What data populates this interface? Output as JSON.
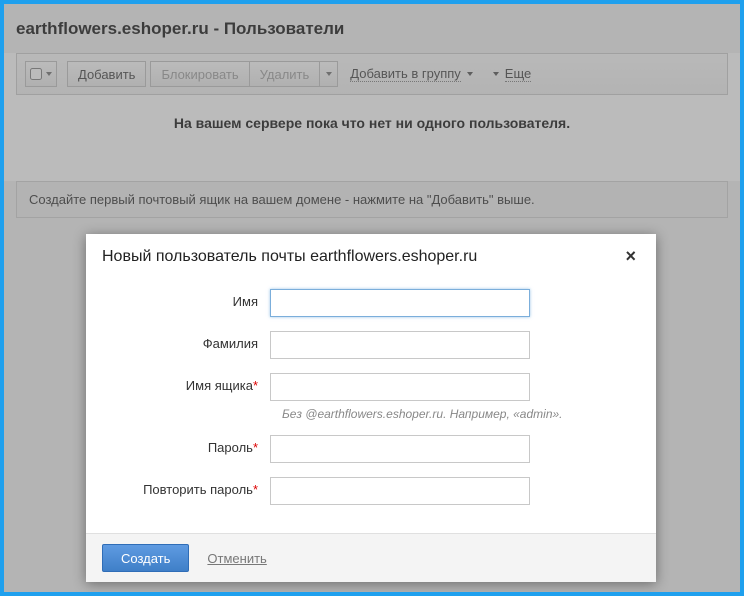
{
  "page": {
    "title": "earthflowers.eshoper.ru - Пользователи"
  },
  "toolbar": {
    "add": "Добавить",
    "block": "Блокировать",
    "delete": "Удалить",
    "add_to_group": "Добавить в группу",
    "more": "Еще"
  },
  "empty_message": "На вашем сервере пока что нет ни одного пользователя.",
  "info_message": "Создайте первый почтовый ящик на вашем домене - нажмите на \"Добавить\" выше.",
  "dialog": {
    "title": "Новый пользователь почты earthflowers.eshoper.ru",
    "fields": {
      "first_name": "Имя",
      "last_name": "Фамилия",
      "mailbox": "Имя ящика",
      "mailbox_hint": "Без @earthflowers.eshoper.ru. Например, «admin».",
      "password": "Пароль",
      "password_confirm": "Повторить пароль"
    },
    "buttons": {
      "create": "Создать",
      "cancel": "Отменить"
    }
  }
}
